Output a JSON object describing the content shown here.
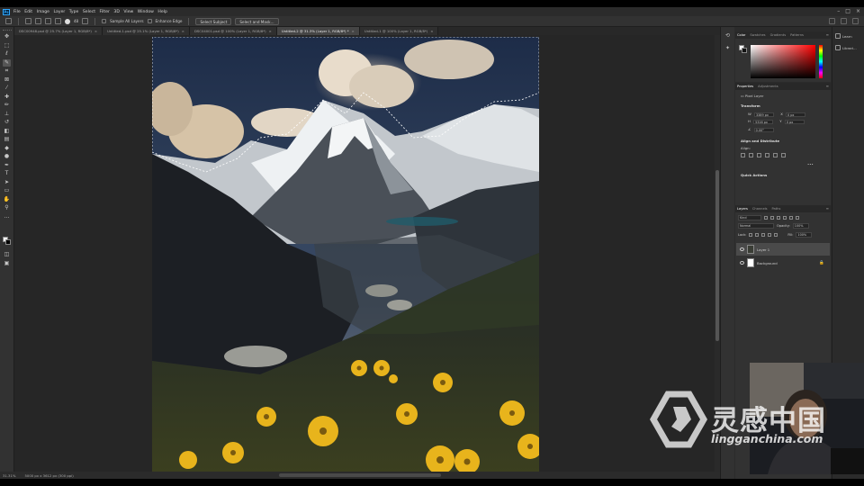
{
  "app": {
    "logo_text": "Ps"
  },
  "menu": [
    "File",
    "Edit",
    "Image",
    "Layer",
    "Type",
    "Select",
    "Filter",
    "3D",
    "View",
    "Window",
    "Help"
  ],
  "options_bar": {
    "size_value": "48",
    "sample_all_layers": "Sample All Layers",
    "enhance_edge": "Enhance Edge",
    "select_subject": "Select Subject",
    "select_and_mask": "Select and Mask..."
  },
  "tabs": [
    {
      "label": "DSC00948.psd @ 25.7% (Layer 1, RGB/8*)",
      "active": false
    },
    {
      "label": "Untitled-1.psd @ 25.1% (Layer 1, RGB/8*)",
      "active": false
    },
    {
      "label": "DSC04001.psd @ 100% (Layer 1, RGB/8*)",
      "active": false
    },
    {
      "label": "Untitled-2 @ 31.3% (Layer 1, RGB/8*) *",
      "active": true
    },
    {
      "label": "Untitled-1 @ 100% (Layer 1, RGB/8*)",
      "active": false
    }
  ],
  "status": {
    "zoom": "31.31%",
    "doc_info": "5000 px x 3612 px (300 ppi)"
  },
  "color_panel": {
    "tabs": [
      "Color",
      "Swatches",
      "Gradients",
      "Patterns"
    ]
  },
  "properties_panel": {
    "tabs": [
      "Properties",
      "Adjustments"
    ],
    "layer_type": "Pixel Layer",
    "transform_heading": "Transform",
    "w_label": "W",
    "w_value": "3389 px",
    "h_label": "H",
    "h_value": "5316 px",
    "x_label": "X",
    "x_value": "0 px",
    "y_label": "Y",
    "y_value": "0 px",
    "angle": "0.00°",
    "align_heading": "Align and Distribute",
    "align_label": "Align:",
    "quick_actions_heading": "Quick Actions"
  },
  "layers_panel": {
    "tabs": [
      "Layers",
      "Channels",
      "Paths"
    ],
    "filter_kind": "Kind",
    "blend_mode": "Normal",
    "opacity_label": "Opacity:",
    "opacity_value": "100%",
    "lock_label": "Lock:",
    "fill_label": "Fill:",
    "fill_value": "100%",
    "layers": [
      {
        "name": "Layer 1",
        "active": true,
        "locked": false
      },
      {
        "name": "Background",
        "active": false,
        "locked": true
      }
    ]
  },
  "libraries": {
    "items": [
      "Learn",
      "Librari..."
    ]
  },
  "watermark": {
    "text": "灵感中国",
    "url": "lingganchina.com"
  },
  "colors": {
    "ui_dark": "#323232",
    "canvas_bg": "#262626",
    "selection": "#ffffff",
    "active_tab": "#454545"
  }
}
